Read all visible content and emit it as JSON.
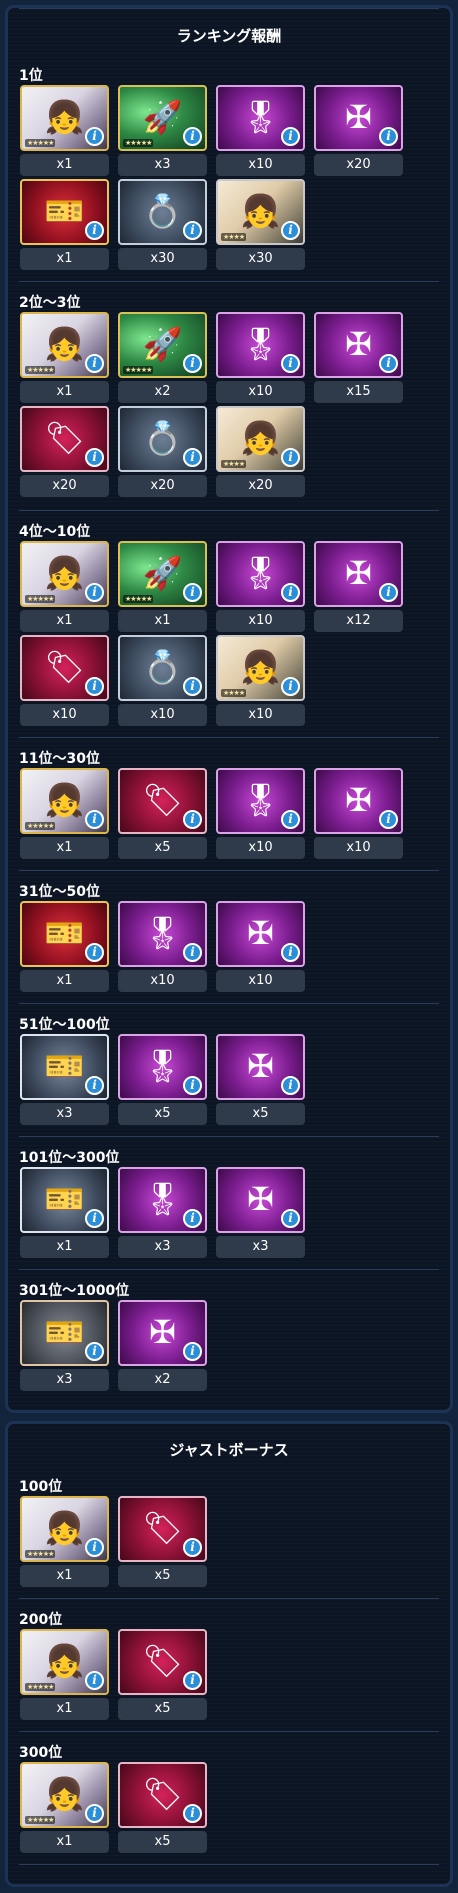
{
  "ranking": {
    "title": "ランキング報酬",
    "tiers": [
      {
        "label": "1位",
        "rows": [
          [
            {
              "icon": "character-card-icon",
              "style": "chara",
              "glyph": "👧",
              "stars": "★★★★★",
              "qty": "x1"
            },
            {
              "icon": "torpedo-icon",
              "style": "torp",
              "glyph": "🚀",
              "stars": "★★★★★",
              "qty": "x3"
            },
            {
              "icon": "medal-icon",
              "style": "purple",
              "glyph": "🎖",
              "qty": "x10"
            },
            {
              "icon": "iron-cross-icon",
              "style": "purple",
              "glyph": "✠",
              "qty": "x20"
            }
          ],
          [
            {
              "icon": "ticket-icon",
              "style": "gold",
              "glyph": "🎫",
              "qty": "x1"
            },
            {
              "icon": "ring-icon",
              "style": "gray",
              "glyph": "💍",
              "qty": "x30"
            },
            {
              "icon": "character-card-icon",
              "style": "chara2",
              "glyph": "👧",
              "stars": "★★★★",
              "qty": "x30"
            }
          ]
        ]
      },
      {
        "label": "2位～3位",
        "rows": [
          [
            {
              "icon": "character-card-icon",
              "style": "chara",
              "glyph": "👧",
              "stars": "★★★★★",
              "qty": "x1"
            },
            {
              "icon": "torpedo-icon",
              "style": "torp",
              "glyph": "🚀",
              "stars": "★★★★★",
              "qty": "x2"
            },
            {
              "icon": "medal-icon",
              "style": "purple",
              "glyph": "🎖",
              "qty": "x10"
            },
            {
              "icon": "iron-cross-icon",
              "style": "purple",
              "glyph": "✠",
              "qty": "x15"
            }
          ],
          [
            {
              "icon": "tag-icon",
              "style": "red",
              "glyph": "🏷",
              "qty": "x20"
            },
            {
              "icon": "ring-icon",
              "style": "gray",
              "glyph": "💍",
              "qty": "x20"
            },
            {
              "icon": "character-card-icon",
              "style": "chara2",
              "glyph": "👧",
              "stars": "★★★★",
              "qty": "x20"
            }
          ]
        ]
      },
      {
        "label": "4位～10位",
        "rows": [
          [
            {
              "icon": "character-card-icon",
              "style": "chara",
              "glyph": "👧",
              "stars": "★★★★★",
              "qty": "x1"
            },
            {
              "icon": "torpedo-icon",
              "style": "torp",
              "glyph": "🚀",
              "stars": "★★★★★",
              "qty": "x1"
            },
            {
              "icon": "medal-icon",
              "style": "purple",
              "glyph": "🎖",
              "qty": "x10"
            },
            {
              "icon": "iron-cross-icon",
              "style": "purple",
              "glyph": "✠",
              "qty": "x12"
            }
          ],
          [
            {
              "icon": "tag-icon",
              "style": "red",
              "glyph": "🏷",
              "qty": "x10"
            },
            {
              "icon": "ring-icon",
              "style": "gray",
              "glyph": "💍",
              "qty": "x10"
            },
            {
              "icon": "character-card-icon",
              "style": "chara2",
              "glyph": "👧",
              "stars": "★★★★",
              "qty": "x10"
            }
          ]
        ]
      },
      {
        "label": "11位～30位",
        "rows": [
          [
            {
              "icon": "character-card-icon",
              "style": "chara",
              "glyph": "👧",
              "stars": "★★★★★",
              "qty": "x1"
            },
            {
              "icon": "tag-icon",
              "style": "red",
              "glyph": "🏷",
              "qty": "x5"
            },
            {
              "icon": "medal-icon",
              "style": "purple",
              "glyph": "🎖",
              "qty": "x10"
            },
            {
              "icon": "iron-cross-icon",
              "style": "purple",
              "glyph": "✠",
              "qty": "x10"
            }
          ]
        ]
      },
      {
        "label": "31位～50位",
        "rows": [
          [
            {
              "icon": "gold-ticket-icon",
              "style": "gold",
              "glyph": "🎫",
              "qty": "x1"
            },
            {
              "icon": "medal-icon",
              "style": "purple",
              "glyph": "🎖",
              "qty": "x10"
            },
            {
              "icon": "iron-cross-icon",
              "style": "purple",
              "glyph": "✠",
              "qty": "x10"
            }
          ]
        ]
      },
      {
        "label": "51位～100位",
        "rows": [
          [
            {
              "icon": "silver-ticket-icon",
              "style": "silver",
              "glyph": "🎫",
              "qty": "x3"
            },
            {
              "icon": "medal-icon",
              "style": "purple",
              "glyph": "🎖",
              "qty": "x5"
            },
            {
              "icon": "iron-cross-icon",
              "style": "purple",
              "glyph": "✠",
              "qty": "x5"
            }
          ]
        ]
      },
      {
        "label": "101位～300位",
        "rows": [
          [
            {
              "icon": "silver-ticket-icon",
              "style": "silver",
              "glyph": "🎫",
              "qty": "x1"
            },
            {
              "icon": "medal-icon",
              "style": "purple",
              "glyph": "🎖",
              "qty": "x3"
            },
            {
              "icon": "iron-cross-icon",
              "style": "purple",
              "glyph": "✠",
              "qty": "x3"
            }
          ]
        ]
      },
      {
        "label": "301位～1000位",
        "rows": [
          [
            {
              "icon": "bronze-ticket-icon",
              "style": "bronze",
              "glyph": "🎫",
              "qty": "x3"
            },
            {
              "icon": "iron-cross-icon",
              "style": "purple",
              "glyph": "✠",
              "qty": "x2"
            }
          ]
        ]
      }
    ]
  },
  "just_bonus": {
    "title": "ジャストボーナス",
    "tiers": [
      {
        "label": "100位",
        "rows": [
          [
            {
              "icon": "character-card-icon",
              "style": "chara",
              "glyph": "👧",
              "stars": "★★★★★",
              "qty": "x1"
            },
            {
              "icon": "tag-icon",
              "style": "red",
              "glyph": "🏷",
              "qty": "x5"
            }
          ]
        ]
      },
      {
        "label": "200位",
        "rows": [
          [
            {
              "icon": "character-card-icon",
              "style": "chara",
              "glyph": "👧",
              "stars": "★★★★★",
              "qty": "x1"
            },
            {
              "icon": "tag-icon",
              "style": "red",
              "glyph": "🏷",
              "qty": "x5"
            }
          ]
        ]
      },
      {
        "label": "300位",
        "rows": [
          [
            {
              "icon": "character-card-icon",
              "style": "chara",
              "glyph": "👧",
              "stars": "★★★★★",
              "qty": "x1"
            },
            {
              "icon": "tag-icon",
              "style": "red",
              "glyph": "🏷",
              "qty": "x5"
            }
          ]
        ]
      }
    ]
  },
  "info_glyph": "i",
  "colors": {
    "background": "#12233c",
    "panel": "#0c1524",
    "panel_border": "#1c3356",
    "qty_bar": "#2f3a4b",
    "info_badge": "#2a8fd8"
  }
}
